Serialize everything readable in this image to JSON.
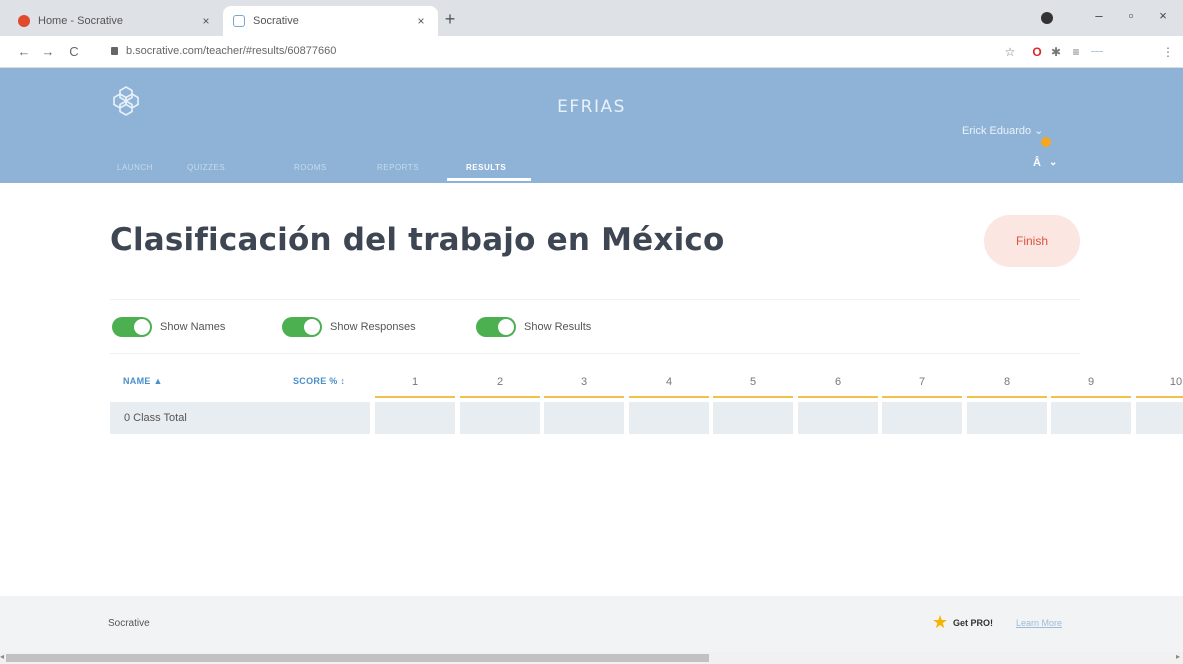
{
  "browser": {
    "tabs": [
      {
        "title": "Home - Socrative",
        "close": "×"
      },
      {
        "title": "Socrative",
        "close": "×"
      }
    ],
    "new_tab": "+",
    "window_controls": {
      "minimize": "–",
      "maximize": "▫",
      "close": "×"
    },
    "url": "b.socrative.com/teacher/#results/60877660",
    "nav": {
      "back": "←",
      "forward": "→",
      "reload": "C"
    },
    "extensions": [
      "☆",
      "O",
      "✱",
      "≡",
      "~~~",
      "⋮"
    ]
  },
  "header": {
    "room": "EFRIAS",
    "user": "Erick Eduardo ⌄",
    "language": "⌄",
    "nav_tabs": [
      {
        "label": "Launch"
      },
      {
        "label": "Quizzes"
      },
      {
        "label": "Rooms"
      },
      {
        "label": "Reports"
      },
      {
        "label": "Results"
      }
    ],
    "active_tab": "Results"
  },
  "main": {
    "title": "Clasificación del trabajo en México",
    "finish_label": "Finish",
    "toggles": [
      {
        "label": "Show Names",
        "on": true
      },
      {
        "label": "Show Responses",
        "on": true
      },
      {
        "label": "Show Results",
        "on": true
      }
    ],
    "table": {
      "name_header": "NAME ▲",
      "score_header": "SCORE % ↕",
      "questions": [
        "1",
        "2",
        "3",
        "4",
        "5",
        "6",
        "7",
        "8",
        "9",
        "10"
      ],
      "rows": [
        {
          "name": "0  Class Total"
        }
      ]
    }
  },
  "footer": {
    "brand": "Socrative",
    "get_pro": "Get PRO!",
    "learn_more": "Learn More"
  },
  "colors": {
    "header_bg": "#8fb3d7",
    "toggle_on": "#4caf50",
    "question_underline": "#f1c24a",
    "finish_bg": "#fbe6e2",
    "finish_text": "#d9553b"
  }
}
